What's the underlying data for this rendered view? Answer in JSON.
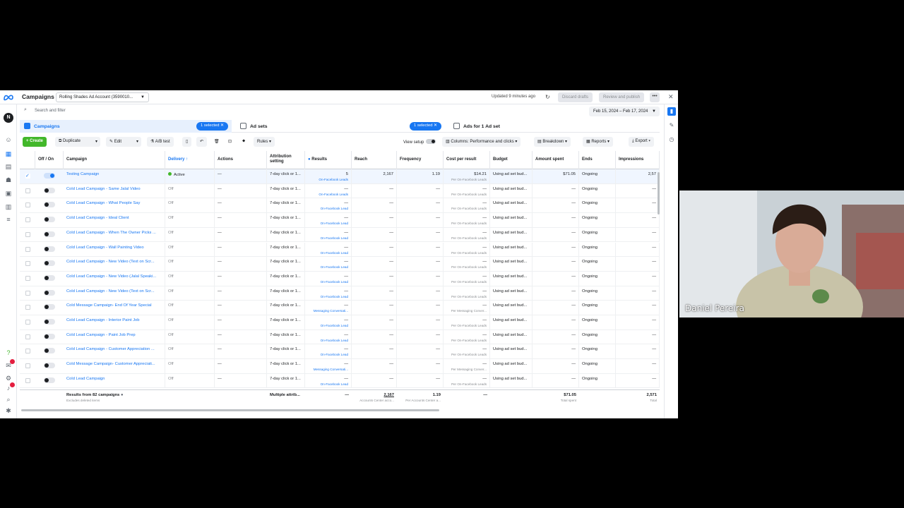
{
  "topbar": {
    "title": "Campaigns",
    "account": "Rolling Shades Ad Account (3590010...",
    "updated": "Updated 9 minutes ago",
    "discard": "Discard drafts",
    "review": "Review and publish"
  },
  "search": {
    "placeholder": "Search and filter",
    "date_range": "Feb 15, 2024 – Feb 17, 2024"
  },
  "tabs": {
    "campaigns": "Campaigns",
    "selected1": "1 selected",
    "adsets": "Ad sets",
    "selected2": "1 selected",
    "ads": "Ads for 1 Ad set"
  },
  "toolbar": {
    "create": "+ Create",
    "duplicate": "Duplicate",
    "edit": "Edit",
    "abtest": "A/B test",
    "rules": "Rules",
    "view_setup": "View setup",
    "columns": "Columns: Performance and clicks",
    "breakdown": "Breakdown",
    "reports": "Reports",
    "export": "Export"
  },
  "columns": {
    "offon": "Off / On",
    "campaign": "Campaign",
    "delivery": "Delivery ↑",
    "actions": "Actions",
    "attribution": "Attribution setting",
    "results": "Results",
    "reach": "Reach",
    "frequency": "Frequency",
    "cpr": "Cost per result",
    "budget": "Budget",
    "spent": "Amount spent",
    "ends": "Ends",
    "impressions": "Impressions"
  },
  "rows": [
    {
      "name": "Testing Campaign",
      "delivery": "Active",
      "actions": "—",
      "attr": "7-day click or 1...",
      "results": "5",
      "results_sub": "On-Facebook Leads",
      "reach": "2,167",
      "freq": "1.19",
      "cpr": "$14.21",
      "cpr_sub": "Per On-Facebook Leads",
      "budget": "Using ad set bud...",
      "spent": "$71.05",
      "ends": "Ongoing",
      "impr": "2,57"
    },
    {
      "name": "Cold Lead Campaign - Same Jalal Video",
      "delivery": "Off",
      "actions": "—",
      "attr": "7-day click or 1...",
      "results": "—",
      "results_sub": "On-Facebook Leads",
      "reach": "—",
      "freq": "—",
      "cpr": "—",
      "cpr_sub": "Per On-Facebook Leads",
      "budget": "Using ad set bud...",
      "spent": "—",
      "ends": "Ongoing",
      "impr": "—"
    },
    {
      "name": "Cold Lead Campaign - What People Say",
      "delivery": "Off",
      "actions": "—",
      "attr": "7-day click or 1...",
      "results": "—",
      "results_sub": "On-Facebook Lead",
      "reach": "—",
      "freq": "—",
      "cpr": "—",
      "cpr_sub": "Per On-Facebook Leads",
      "budget": "Using ad set bud...",
      "spent": "—",
      "ends": "Ongoing",
      "impr": "—"
    },
    {
      "name": "Cold Lead Campaign - Ideal Client",
      "delivery": "Off",
      "actions": "—",
      "attr": "7-day click or 1...",
      "results": "—",
      "results_sub": "On-Facebook Lead",
      "reach": "—",
      "freq": "—",
      "cpr": "—",
      "cpr_sub": "Per On-Facebook Leads",
      "budget": "Using ad set bud...",
      "spent": "—",
      "ends": "Ongoing",
      "impr": "—"
    },
    {
      "name": "Cold Lead Campaign - When The Owner Picks ...",
      "delivery": "Off",
      "actions": "—",
      "attr": "7-day click or 1...",
      "results": "—",
      "results_sub": "On-Facebook Lead",
      "reach": "—",
      "freq": "—",
      "cpr": "—",
      "cpr_sub": "Per On-Facebook Leads",
      "budget": "Using ad set bud...",
      "spent": "—",
      "ends": "Ongoing",
      "impr": "—"
    },
    {
      "name": "Cold Lead Campaign - Wall Painting Video",
      "delivery": "Off",
      "actions": "—",
      "attr": "7-day click or 1...",
      "results": "—",
      "results_sub": "On-Facebook Lead",
      "reach": "—",
      "freq": "—",
      "cpr": "—",
      "cpr_sub": "Per On-Facebook Leads",
      "budget": "Using ad set bud...",
      "spent": "—",
      "ends": "Ongoing",
      "impr": "—"
    },
    {
      "name": "Cold Lead Campaign - New Video (Text on Scr...",
      "delivery": "Off",
      "actions": "—",
      "attr": "7-day click or 1...",
      "results": "—",
      "results_sub": "On-Facebook Lead",
      "reach": "—",
      "freq": "—",
      "cpr": "—",
      "cpr_sub": "Per On-Facebook Leads",
      "budget": "Using ad set bud...",
      "spent": "—",
      "ends": "Ongoing",
      "impr": "—"
    },
    {
      "name": "Cold Lead Campaign - New Video (Jalal Speaki...",
      "delivery": "Off",
      "actions": "—",
      "attr": "7-day click or 1...",
      "results": "—",
      "results_sub": "On-Facebook Lead",
      "reach": "—",
      "freq": "—",
      "cpr": "—",
      "cpr_sub": "Per On-Facebook Leads",
      "budget": "Using ad set bud...",
      "spent": "—",
      "ends": "Ongoing",
      "impr": "—"
    },
    {
      "name": "Cold Lead Campaign - New Video (Text on Scr...",
      "delivery": "Off",
      "actions": "—",
      "attr": "7-day click or 1...",
      "results": "—",
      "results_sub": "On-Facebook Lead",
      "reach": "—",
      "freq": "—",
      "cpr": "—",
      "cpr_sub": "Per On-Facebook Leads",
      "budget": "Using ad set bud...",
      "spent": "—",
      "ends": "Ongoing",
      "impr": "—"
    },
    {
      "name": "Cold Message Campaign- End Of Year Special",
      "delivery": "Off",
      "actions": "—",
      "attr": "7-day click or 1...",
      "results": "—",
      "results_sub": "Messaging Conversati...",
      "reach": "—",
      "freq": "—",
      "cpr": "—",
      "cpr_sub": "Per Messaging Conver...",
      "budget": "Using ad set bud...",
      "spent": "—",
      "ends": "Ongoing",
      "impr": "—"
    },
    {
      "name": "Cold Lead Campaign - Interior Paint Job",
      "delivery": "Off",
      "actions": "—",
      "attr": "7-day click or 1...",
      "results": "—",
      "results_sub": "On-Facebook Lead",
      "reach": "—",
      "freq": "—",
      "cpr": "—",
      "cpr_sub": "Per On-Facebook Leads",
      "budget": "Using ad set bud...",
      "spent": "—",
      "ends": "Ongoing",
      "impr": "—"
    },
    {
      "name": "Cold Lead Campaign - Paint Job Prep",
      "delivery": "Off",
      "actions": "—",
      "attr": "7-day click or 1...",
      "results": "—",
      "results_sub": "On-Facebook Lead",
      "reach": "—",
      "freq": "—",
      "cpr": "—",
      "cpr_sub": "Per On-Facebook Leads",
      "budget": "Using ad set bud...",
      "spent": "—",
      "ends": "Ongoing",
      "impr": "—"
    },
    {
      "name": "Cold Lead Campaign - Customer Appreciation ...",
      "delivery": "Off",
      "actions": "—",
      "attr": "7-day click or 1...",
      "results": "—",
      "results_sub": "On-Facebook Lead",
      "reach": "—",
      "freq": "—",
      "cpr": "—",
      "cpr_sub": "Per On-Facebook Leads",
      "budget": "Using ad set bud...",
      "spent": "—",
      "ends": "Ongoing",
      "impr": "—"
    },
    {
      "name": "Cold Message Campaign- Customer Appreciati...",
      "delivery": "Off",
      "actions": "—",
      "attr": "7-day click or 1...",
      "results": "—",
      "results_sub": "Messaging Conversati...",
      "reach": "—",
      "freq": "—",
      "cpr": "—",
      "cpr_sub": "Per Messaging Conver...",
      "budget": "Using ad set bud...",
      "spent": "—",
      "ends": "Ongoing",
      "impr": "—"
    },
    {
      "name": "Cold Lead Campaign",
      "delivery": "Off",
      "actions": "—",
      "attr": "7-day click or 1...",
      "results": "—",
      "results_sub": "On-Facebook Lead",
      "reach": "—",
      "freq": "—",
      "cpr": "—",
      "cpr_sub": "Per On-Facebook Leads",
      "budget": "Using ad set bud...",
      "spent": "—",
      "ends": "Ongoing",
      "impr": "—"
    }
  ],
  "totals": {
    "label": "Results from 82 campaigns",
    "label_sub": "Excludes deleted items",
    "attr": "Multiple attrib...",
    "results": "—",
    "reach": "2,167",
    "reach_sub": "Accounts Center acco...",
    "freq": "1.19",
    "freq_sub": "Per Accounts Center a...",
    "cpr": "—",
    "spent": "$71.05",
    "spent_sub": "Total spent",
    "impr": "2,571",
    "impr_sub": "Total"
  },
  "webcam": {
    "name": "Daniel Pereira"
  },
  "colors": {
    "accent": "#1877f2",
    "create": "#42b72a",
    "active": "#42b72a"
  }
}
